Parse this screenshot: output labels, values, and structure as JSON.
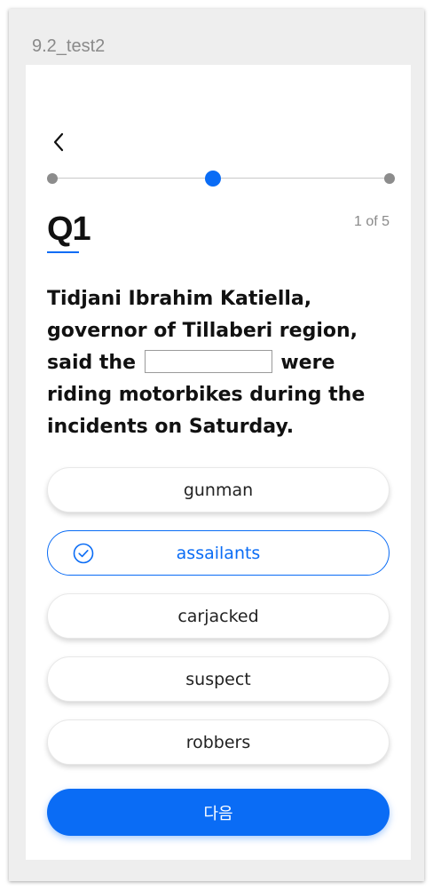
{
  "window": {
    "title": "9.2_test2"
  },
  "stepper": {
    "steps": 3,
    "current_step": 2
  },
  "question": {
    "number": "Q1",
    "progress": "1 of 5",
    "text_before": "Tidjani Ibrahim Katiella, governor of Tillaberi region, said the",
    "text_after": "were riding motorbikes during the incidents on Saturday."
  },
  "options": [
    {
      "label": "gunman",
      "selected": false
    },
    {
      "label": "assailants",
      "selected": true
    },
    {
      "label": "carjacked",
      "selected": false
    },
    {
      "label": "suspect",
      "selected": false
    },
    {
      "label": "robbers",
      "selected": false
    }
  ],
  "next_button": {
    "label": "다음"
  },
  "colors": {
    "accent": "#0a6cf5",
    "muted_dot": "#8c8c8c",
    "text": "#111111"
  },
  "icons": {
    "back": "chevron-left-icon",
    "selected": "check-circle-icon"
  }
}
